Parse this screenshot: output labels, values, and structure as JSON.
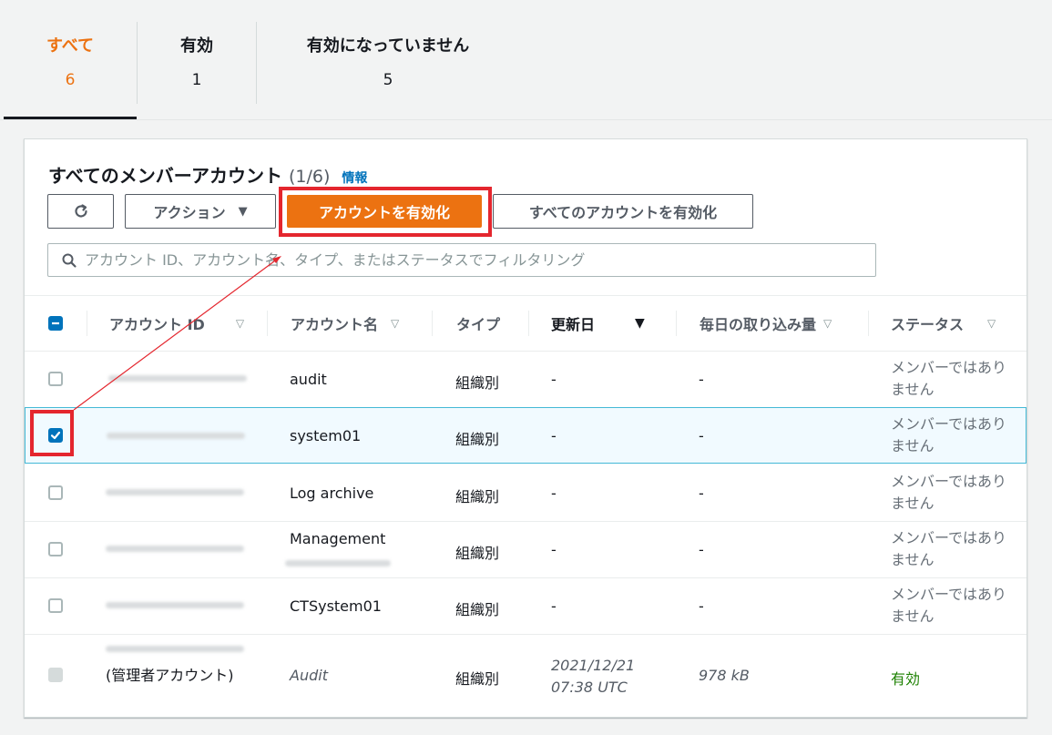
{
  "tabs": [
    {
      "label": "すべて",
      "count": "6"
    },
    {
      "label": "有効",
      "count": "1"
    },
    {
      "label": "有効になっていません",
      "count": "5"
    }
  ],
  "panel": {
    "title": "すべてのメンバーアカウント",
    "count": "(1/6)",
    "info_link": "情報"
  },
  "toolbar": {
    "refresh_icon": "refresh-icon",
    "actions_label": "アクション",
    "enable_account_label": "アカウントを有効化",
    "enable_all_label": "すべてのアカウントを有効化"
  },
  "search": {
    "placeholder": "アカウント ID、アカウント名、タイプ、またはステータスでフィルタリング"
  },
  "table": {
    "columns": [
      "アカウント ID",
      "アカウント名",
      "タイプ",
      "更新日",
      "毎日の取り込み量",
      "ステータス"
    ],
    "rows": [
      {
        "name": "audit",
        "type": "組織別",
        "updated": "-",
        "ingestion": "-",
        "status": "メンバーではありません",
        "checked": false
      },
      {
        "name": "system01",
        "type": "組織別",
        "updated": "-",
        "ingestion": "-",
        "status": "メンバーではありません",
        "checked": true
      },
      {
        "name": "Log archive",
        "type": "組織別",
        "updated": "-",
        "ingestion": "-",
        "status": "メンバーではありません",
        "checked": false
      },
      {
        "name": "Management",
        "type": "組織別",
        "updated": "-",
        "ingestion": "-",
        "status": "メンバーではありません",
        "checked": false
      },
      {
        "name": "CTSystem01",
        "type": "組織別",
        "updated": "-",
        "ingestion": "-",
        "status": "メンバーではありません",
        "checked": false
      },
      {
        "name": "Audit",
        "type": "組織別",
        "updated": "2021/12/21 07:38 UTC",
        "ingestion": "978 kB",
        "status": "有効",
        "admin_note": "(管理者アカウント)",
        "checked": false
      }
    ]
  },
  "colors": {
    "accent": "#ec7211",
    "link": "#0073bb",
    "highlight": "#e4262e",
    "success": "#1d8102"
  }
}
